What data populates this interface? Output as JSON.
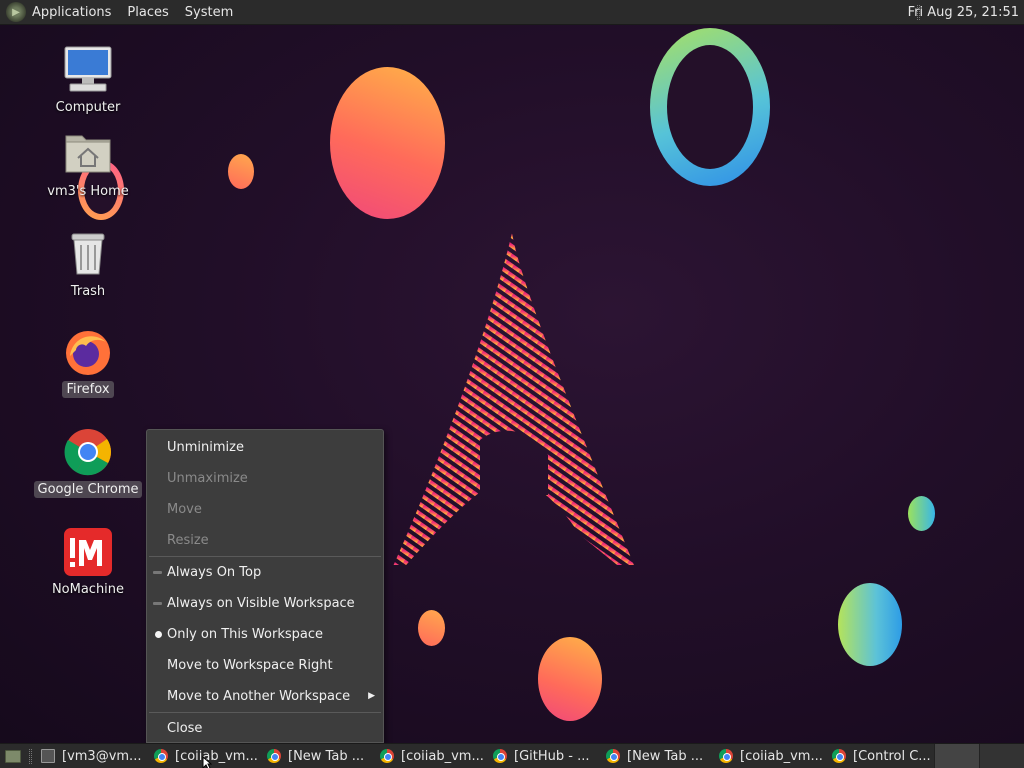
{
  "top_panel": {
    "menus": [
      "Applications",
      "Places",
      "System"
    ],
    "clock": "Fri Aug 25, 21:51"
  },
  "desktop_icons": [
    {
      "label": "Computer",
      "icon": "computer-icon"
    },
    {
      "label": "vm3's Home",
      "icon": "home-folder-icon"
    },
    {
      "label": "Trash",
      "icon": "trash-icon"
    },
    {
      "label": "Firefox",
      "icon": "firefox-icon"
    },
    {
      "label": "Google Chrome",
      "icon": "chrome-icon"
    },
    {
      "label": "NoMachine",
      "icon": "nomachine-icon"
    }
  ],
  "context_menu": {
    "items": [
      {
        "label": "Unminimize"
      },
      {
        "label": "Unmaximize"
      },
      {
        "label": "Move"
      },
      {
        "label": "Resize"
      },
      {
        "label": "Always On Top"
      },
      {
        "label": "Always on Visible Workspace"
      },
      {
        "label": "Only on This Workspace"
      },
      {
        "label": "Move to Workspace Right"
      },
      {
        "label": "Move to Another Workspace"
      },
      {
        "label": "Close"
      }
    ]
  },
  "taskbar": {
    "tasks": [
      {
        "label": "[vm3@vm...",
        "icon": "terminal-icon"
      },
      {
        "label": "[coiiab_vm...",
        "icon": "chrome-icon"
      },
      {
        "label": "[New Tab ...",
        "icon": "chrome-icon"
      },
      {
        "label": "[coiiab_vm...",
        "icon": "chrome-icon"
      },
      {
        "label": "[GitHub - ...",
        "icon": "chrome-icon"
      },
      {
        "label": "[New Tab ...",
        "icon": "chrome-icon"
      },
      {
        "label": "[coiiab_vm...",
        "icon": "chrome-icon"
      },
      {
        "label": "[Control C...",
        "icon": "chrome-icon"
      }
    ]
  }
}
